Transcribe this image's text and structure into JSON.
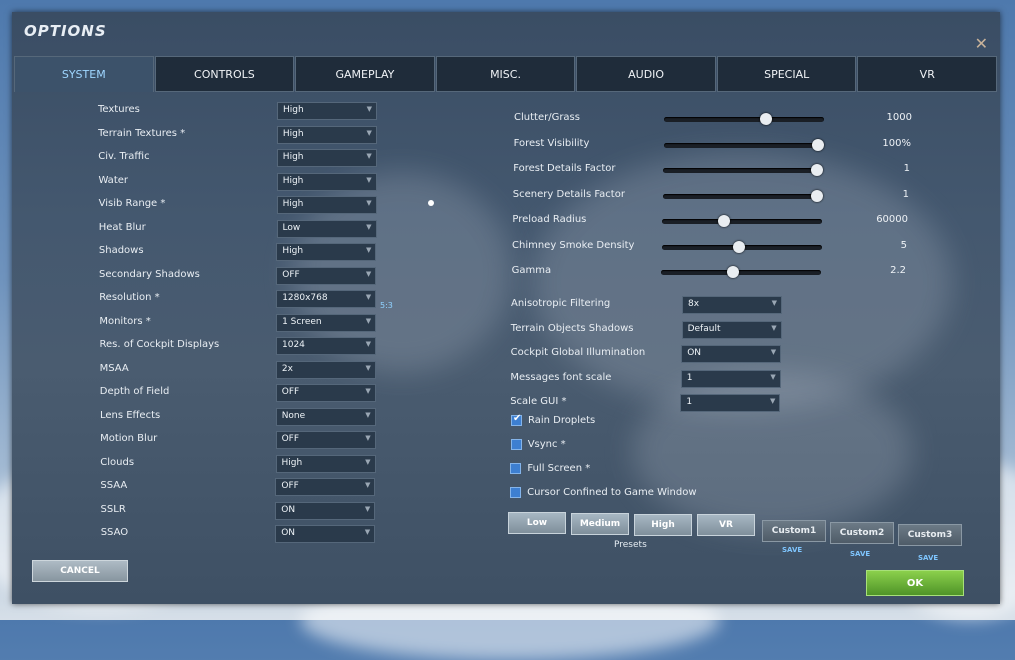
{
  "window": {
    "title": "OPTIONS",
    "close_glyph": "✕"
  },
  "tabs": [
    {
      "label": "SYSTEM",
      "active": true
    },
    {
      "label": "CONTROLS"
    },
    {
      "label": "GAMEPLAY"
    },
    {
      "label": "MISC."
    },
    {
      "label": "AUDIO"
    },
    {
      "label": "SPECIAL"
    },
    {
      "label": "VR"
    }
  ],
  "left_settings": [
    {
      "label": "Textures",
      "value": "High"
    },
    {
      "label": "Terrain Textures *",
      "value": "High"
    },
    {
      "label": "Civ. Traffic",
      "value": "High"
    },
    {
      "label": "Water",
      "value": "High"
    },
    {
      "label": "Visib Range *",
      "value": "High"
    },
    {
      "label": "Heat Blur",
      "value": "Low"
    },
    {
      "label": "Shadows",
      "value": "High"
    },
    {
      "label": "Secondary Shadows",
      "value": "OFF"
    },
    {
      "label": "Resolution *",
      "value": "1280x768"
    },
    {
      "label": "Monitors *",
      "value": "1 Screen"
    },
    {
      "label": "Res. of Cockpit Displays",
      "value": "1024"
    },
    {
      "label": "MSAA",
      "value": "2x"
    },
    {
      "label": "Depth of Field",
      "value": "OFF"
    },
    {
      "label": "Lens Effects",
      "value": "None"
    },
    {
      "label": "Motion Blur",
      "value": "OFF"
    },
    {
      "label": "Clouds",
      "value": "High"
    },
    {
      "label": "SSAA",
      "value": "OFF"
    },
    {
      "label": "SSLR",
      "value": "ON"
    },
    {
      "label": "SSAO",
      "value": "ON"
    }
  ],
  "resolution_ratio": "5:3",
  "sliders": [
    {
      "label": "Clutter/Grass",
      "value_text": "1000",
      "level": 0.66
    },
    {
      "label": "Forest Visibility",
      "value_text": "100%",
      "level": 1.0
    },
    {
      "label": "Forest Details Factor",
      "value_text": "1",
      "level": 1.0
    },
    {
      "label": "Scenery Details Factor",
      "value_text": "1",
      "level": 1.0
    },
    {
      "label": "Preload Radius",
      "value_text": "60000",
      "level": 0.4
    },
    {
      "label": "Chimney Smoke Density",
      "value_text": "5",
      "level": 0.5
    },
    {
      "label": "Gamma",
      "value_text": "2.2",
      "level": 0.47
    }
  ],
  "right_settings": [
    {
      "label": "Anisotropic Filtering",
      "value": "8x"
    },
    {
      "label": "Terrain Objects Shadows",
      "value": "Default"
    },
    {
      "label": "Cockpit Global Illumination",
      "value": "ON"
    },
    {
      "label": "Messages font scale",
      "value": "1"
    },
    {
      "label": "Scale GUI *",
      "value": "1"
    }
  ],
  "checkboxes": [
    {
      "label": "Rain Droplets",
      "checked": true
    },
    {
      "label": "Vsync *",
      "checked": false
    },
    {
      "label": "Full Screen *",
      "checked": false
    },
    {
      "label": "Cursor Confined to Game Window",
      "checked": false
    }
  ],
  "presets": {
    "label": "Presets",
    "buttons": [
      "Low",
      "Medium",
      "High",
      "VR"
    ],
    "custom": [
      "Custom1",
      "Custom2",
      "Custom3"
    ],
    "save_label": "SAVE"
  },
  "footer": {
    "cancel_label": "CANCEL",
    "ok_label": "OK"
  },
  "colors": {
    "active_tab_text": "#9fd6ff",
    "ok_green": "#4f9428",
    "checkbox_blue": "#3d7fd1"
  }
}
